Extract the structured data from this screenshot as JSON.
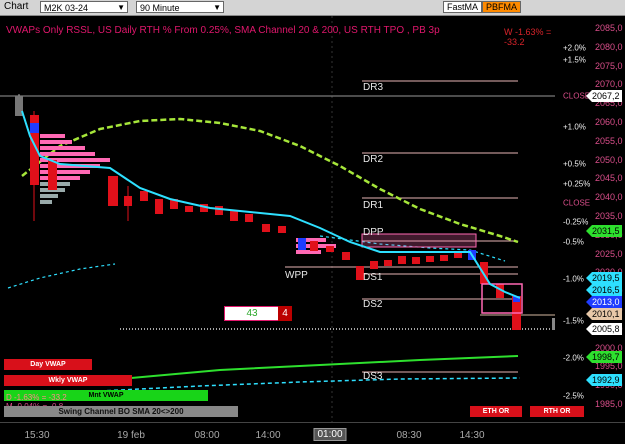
{
  "toolbar": {
    "title": "Chart",
    "symbol": "M2K 03-24",
    "interval": "90 Minute",
    "btn1": "FastMA",
    "btn2": "PBFMA"
  },
  "indicator_title": "VWAPs Only RSSL, US Daily RTH % From 0.25%, SMA Channel 20 & 200, US RTH TPO , PB 3p",
  "w_readout": "W -1.63% = -33.2",
  "price_axis": [
    "2085,0",
    "2080,0",
    "2075,0",
    "2070,0",
    "2065,0",
    "2060,0",
    "2055,0",
    "2050,0",
    "2045,0",
    "2040,0",
    "2035,0",
    "2030,0",
    "2025,0",
    "2020,0",
    "2015,0",
    "2010,0",
    "2005,0",
    "2000,0",
    "1995,0",
    "1990,0",
    "1985,0"
  ],
  "pct_labels": [
    "+2.0%",
    "+1.5%",
    "CLOSE",
    "+1.0%",
    "+0.5%",
    "+0.25%",
    "CLOSE",
    "-0.25%",
    "-0.5%",
    "-1.0%",
    "-1.5%",
    "-2.0%",
    "-2.5%"
  ],
  "price_tags": [
    {
      "label": "2067,2",
      "color": "#ffffff"
    },
    {
      "label": "2031,5",
      "color": "#2ee02e"
    },
    {
      "label": "2019,5",
      "color": "#2ee0ff"
    },
    {
      "label": "2016,5",
      "color": "#2ee0ff"
    },
    {
      "label": "2013,0",
      "color": "#1f3cff"
    },
    {
      "label": "2010,1",
      "color": "#e8c8a8"
    },
    {
      "label": "2005,8",
      "color": "#ffffff"
    },
    {
      "label": "1998,7",
      "color": "#2ee02e"
    },
    {
      "label": "1992,9",
      "color": "#2ee0ff"
    }
  ],
  "close_tags": [
    "CLOSE",
    "CLOSE"
  ],
  "levels": [
    "DR3",
    "DR2",
    "DR1",
    "DPP",
    "WPP",
    "DS1",
    "DS2",
    "DS3"
  ],
  "box_left": "43",
  "box_right": "4",
  "buttons": {
    "day_vwap": "Day VWAP",
    "wkly_vwap": "Wkly VWAP",
    "mnt_vwap": "Mnt VWAP",
    "d_readout": "D -1.63% = -33.2",
    "m_readout": "M -0.04% = -0.8",
    "swing": "Swing Channel BO SMA 20<>200",
    "eth_or": "ETH OR",
    "rth_or": "RTH OR"
  },
  "time_axis": [
    "15:30",
    "19 feb",
    "08:00",
    "14:00",
    "01:00",
    "08:30",
    "14:30"
  ],
  "colors": {
    "up": "#1f3cff",
    "down": "#e0101a",
    "vwap": "#2ee0ff",
    "sma200": "#a6e63a",
    "profile": "#ff69b4"
  }
}
